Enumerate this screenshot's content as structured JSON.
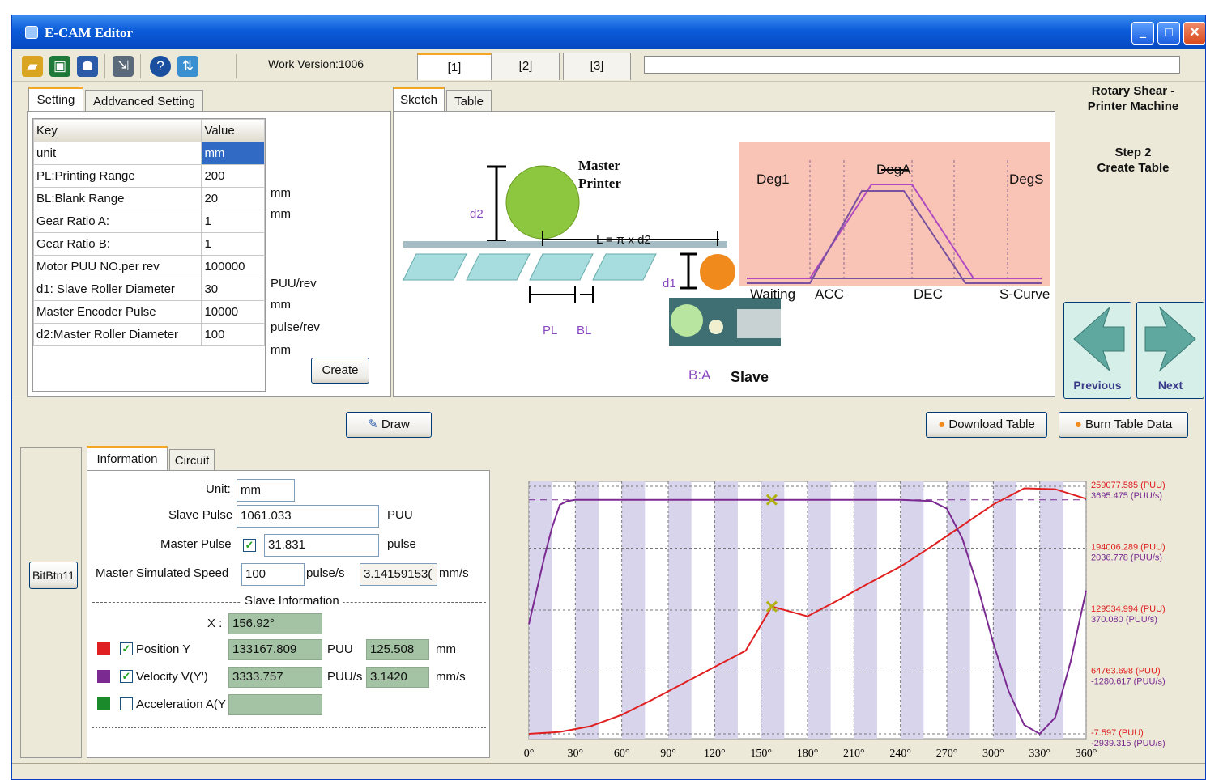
{
  "window": {
    "title": "E-CAM Editor"
  },
  "toolbar": {
    "work_version": "Work Version:1006",
    "tabs": [
      "[1]",
      "[2]",
      "[3]"
    ],
    "icons": [
      "open-folder-icon",
      "save-icon",
      "connect-icon",
      "export-icon",
      "help-icon",
      "signal-icon"
    ]
  },
  "settings": {
    "tabs": [
      "Setting",
      "Addvanced Setting"
    ],
    "header_key": "Key",
    "header_value": "Value",
    "rows": [
      {
        "key": "unit",
        "value": "mm",
        "unit": ""
      },
      {
        "key": "PL:Printing Range",
        "value": "200",
        "unit": "mm"
      },
      {
        "key": "BL:Blank Range",
        "value": "20",
        "unit": "mm"
      },
      {
        "key": "Gear Ratio A:",
        "value": "1",
        "unit": ""
      },
      {
        "key": "Gear Ratio B:",
        "value": "1",
        "unit": ""
      },
      {
        "key": "Motor PUU NO.per rev",
        "value": "100000",
        "unit": "PUU/rev"
      },
      {
        "key": "d1: Slave Roller Diameter",
        "value": "30",
        "unit": "mm"
      },
      {
        "key": "Master Encoder Pulse",
        "value": "10000",
        "unit": "pulse/rev"
      },
      {
        "key": "d2:Master Roller Diameter",
        "value": "100",
        "unit": "mm"
      }
    ],
    "create_label": "Create"
  },
  "sketch": {
    "tabs": [
      "Sketch",
      "Table"
    ],
    "master_label": "Master\nPrinter",
    "d2": "d2",
    "length_formula": "L = π x d2",
    "d1": "d1",
    "pl": "PL",
    "bl": "BL",
    "ratio": "B:A",
    "slave": "Slave",
    "curve": {
      "deg1": "Deg1",
      "dega": "DegA",
      "degs": "DegS",
      "waiting": "Waiting",
      "acc": "ACC",
      "dec": "DEC",
      "scurve": "S-Curve"
    }
  },
  "step": {
    "machine": "Rotary Shear -\nPrinter Machine",
    "step": "Step 2\nCreate Table",
    "previous": "Previous",
    "next": "Next"
  },
  "actions": {
    "draw": "Draw",
    "download": "Download Table",
    "burn": "Burn Table Data"
  },
  "info": {
    "side_button": "BitBtn11",
    "tabs": [
      "Information",
      "Circuit"
    ],
    "unit_label": "Unit:",
    "unit_value": "mm",
    "slave_pulse_label": "Slave Pulse",
    "slave_pulse_value": "1061.033",
    "slave_pulse_unit": "PUU",
    "master_pulse_label": "Master Pulse",
    "master_pulse_value": "31.831",
    "master_pulse_unit": "pulse",
    "speed_label": "Master Simulated Speed",
    "speed_value": "100",
    "speed_unit": "pulse/s",
    "speed_mm": "3.14159153(",
    "speed_mm_unit": "mm/s",
    "slave_info": "Slave Information",
    "x_label": "X :",
    "x_value": "156.92°",
    "position_label": "Position Y",
    "position_puu": "133167.809",
    "position_puu_unit": "PUU",
    "position_mm": "125.508",
    "position_mm_unit": "mm",
    "velocity_label": "Velocity V(Y')",
    "velocity_puu": "3333.757",
    "velocity_puu_unit": "PUU/s",
    "velocity_mm": "3.1420",
    "velocity_mm_unit": "mm/s",
    "accel_label": "Acceleration A(Y",
    "colors": {
      "position": "#e02020",
      "velocity": "#7a2a90",
      "accel": "#1a8a2a"
    }
  },
  "chart_data": {
    "type": "line",
    "x_ticks": [
      "0°",
      "30°",
      "60°",
      "90°",
      "120°",
      "150°",
      "180°",
      "210°",
      "240°",
      "270°",
      "300°",
      "330°",
      "360°"
    ],
    "xlim": [
      0,
      360
    ],
    "right_labels": [
      {
        "puu": "259077.585 (PUU)",
        "puus": "3695.475 (PUU/s)"
      },
      {
        "puu": "194006.289 (PUU)",
        "puus": "2036.778 (PUU/s)"
      },
      {
        "puu": "129534.994 (PUU)",
        "puus": "370.080 (PUU/s)"
      },
      {
        "puu": "64763.698 (PUU)",
        "puus": "-1280.617 (PUU/s)"
      },
      {
        "puu": "-7.597 (PUU)",
        "puus": "-2939.315 (PUU/s)"
      }
    ],
    "position_ylim": [
      -7.597,
      259077.585
    ],
    "velocity_ylim": [
      -2939.315,
      3695.475
    ],
    "series": [
      {
        "name": "Position Y",
        "color": "#e02020",
        "x": [
          0,
          20,
          40,
          60,
          80,
          100,
          120,
          140,
          156.92,
          180,
          200,
          220,
          240,
          260,
          280,
          300,
          320,
          340,
          360
        ],
        "values": [
          0,
          2000,
          8000,
          20000,
          36000,
          53000,
          70000,
          87000,
          133167.809,
          123000,
          140000,
          158000,
          175000,
          196000,
          218000,
          240000,
          257000,
          256000,
          246000
        ]
      },
      {
        "name": "Velocity V(Y')",
        "color": "#7a2a90",
        "x": [
          0,
          5,
          10,
          15,
          20,
          25,
          30,
          40,
          60,
          90,
          120,
          150,
          180,
          210,
          240,
          260,
          270,
          280,
          290,
          300,
          310,
          320,
          330,
          340,
          350,
          360
        ],
        "values": [
          0,
          900,
          1800,
          2600,
          3200,
          3300,
          3333,
          3333,
          3333,
          3333,
          3333,
          3333,
          3333,
          3333,
          3333,
          3300,
          3100,
          2300,
          1000,
          -500,
          -1800,
          -2700,
          -2939,
          -2500,
          -1000,
          900
        ]
      }
    ],
    "markers": [
      {
        "x": 156.92,
        "series": "Velocity V(Y')",
        "y": 3333.757
      },
      {
        "x": 156.92,
        "series": "Position Y",
        "y": 133167.809
      }
    ]
  }
}
